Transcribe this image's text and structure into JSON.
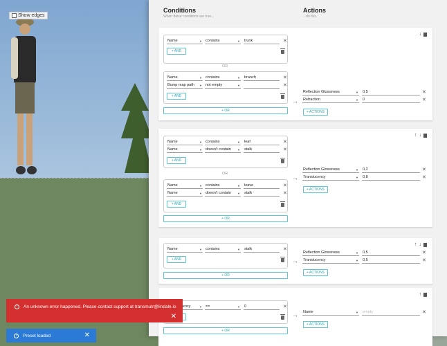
{
  "scene": {
    "show_edges_label": "Show edges"
  },
  "header": {
    "conditions_title": "Conditions",
    "conditions_subtitle": "When these conditions are true...",
    "actions_title": "Actions",
    "actions_subtitle": "...do this."
  },
  "buttons": {
    "and": "+ AND",
    "or": "+ OR",
    "actions": "+ ACTIONS"
  },
  "or_separator": "OR",
  "rules": [
    {
      "groups": [
        [
          {
            "field": "Name",
            "op": "contains",
            "value": "trunk"
          }
        ],
        [
          {
            "field": "Name",
            "op": "contains",
            "value": "branch"
          },
          {
            "field": "Bump map path",
            "op": "not empty",
            "value": ""
          }
        ]
      ],
      "actions": [
        {
          "prop": "Reflection Glossiness",
          "value": "0,5"
        },
        {
          "prop": "Refraction",
          "value": "0"
        }
      ]
    },
    {
      "groups": [
        [
          {
            "field": "Name",
            "op": "contains",
            "value": "leaf"
          },
          {
            "field": "Name",
            "op": "doesn't contain",
            "value": "stalk"
          }
        ],
        [
          {
            "field": "Name",
            "op": "contains",
            "value": "leave"
          },
          {
            "field": "Name",
            "op": "doesn't contain",
            "value": "stalk"
          }
        ]
      ],
      "actions": [
        {
          "prop": "Reflection Glossiness",
          "value": "0,2"
        },
        {
          "prop": "Translucency",
          "value": "0,8"
        }
      ]
    },
    {
      "groups": [
        [
          {
            "field": "Name",
            "op": "contains",
            "value": "stalk"
          }
        ]
      ],
      "actions": [
        {
          "prop": "Reflection Glossiness",
          "value": "0,5"
        },
        {
          "prop": "Translucency",
          "value": "0,5"
        }
      ]
    },
    {
      "groups": [
        [
          {
            "field": "Transparency",
            "op": "==",
            "value": "0"
          }
        ]
      ],
      "actions": [
        {
          "prop": "Name",
          "value": "",
          "placeholder": "empty"
        }
      ]
    }
  ],
  "toasts": {
    "error": "An unknown error happened. Please contact support at transmutr@lindale.io",
    "info": "Preset loaded"
  },
  "icons": [
    "arrow-up-icon",
    "arrow-down-icon",
    "trash-icon",
    "close-icon",
    "arrow-right-icon",
    "chevron-down-icon",
    "info-icon"
  ]
}
